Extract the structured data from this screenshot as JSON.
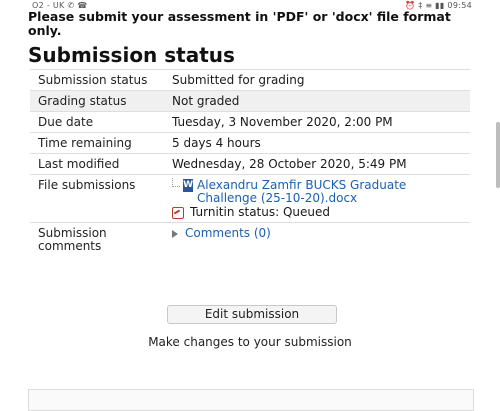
{
  "statusbar": {
    "left": "O2 - UK ✆ ☎",
    "right": "⏰ ‡ ≡ ▮▮ 09:54"
  },
  "notice": "Please submit your assessment in 'PDF' or 'docx' file format only.",
  "heading": "Submission status",
  "rows": {
    "submission_status": {
      "label": "Submission status",
      "value": "Submitted for grading"
    },
    "grading_status": {
      "label": "Grading status",
      "value": "Not graded"
    },
    "due_date": {
      "label": "Due date",
      "value": "Tuesday, 3 November 2020, 2:00 PM"
    },
    "time_remaining": {
      "label": "Time remaining",
      "value": "5 days 4 hours"
    },
    "last_modified": {
      "label": "Last modified",
      "value": "Wednesday, 28 October 2020, 5:49 PM"
    },
    "file_submissions": {
      "label": "File submissions",
      "file_name": "Alexandru Zamfir BUCKS Graduate Challenge (25-10-20).docx",
      "file_icon_glyph": "W",
      "turnitin": "Turnitin status: Queued"
    },
    "submission_comments": {
      "label": "Submission comments",
      "link": "Comments (0)"
    }
  },
  "edit_button": "Edit submission",
  "edit_hint": "Make changes to your submission",
  "icons": {
    "file": "word-document-icon",
    "turnitin": "turnitin-icon",
    "expand": "expand-triangle-icon"
  },
  "colors": {
    "link": "#1a5fb4",
    "shaded_row": "#f0f0f0",
    "word_icon": "#2b579a"
  }
}
